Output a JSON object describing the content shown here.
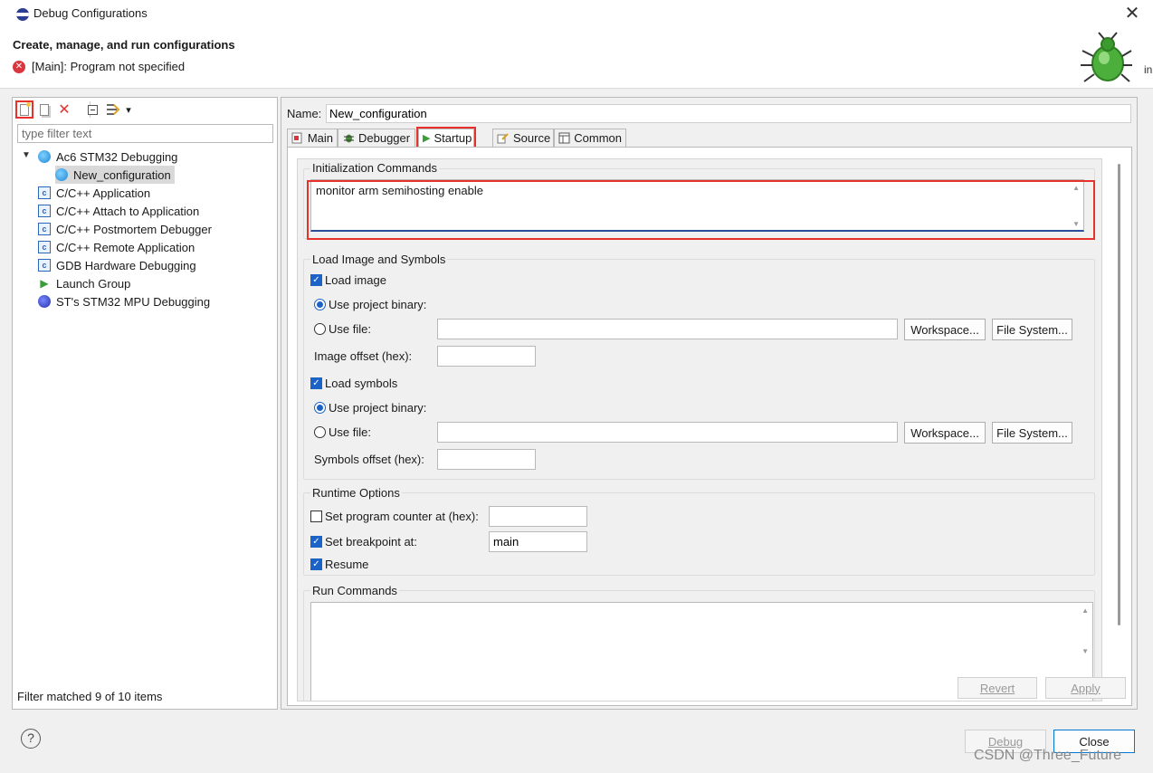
{
  "window": {
    "title": "Debug Configurations",
    "close_glyph": "✕",
    "side_peek_text": "in"
  },
  "header": {
    "title": "Create, manage, and run configurations",
    "error_glyph": "✕",
    "error_message": "[Main]: Program not specified"
  },
  "left": {
    "toolbar": [
      "new-configuration-icon",
      "duplicate-icon",
      "delete-icon",
      "collapse-all-icon",
      "filter-icon",
      "dropdown-icon"
    ],
    "filter_placeholder": "type filter text",
    "tree": [
      {
        "label": "Ac6 STM32 Debugging",
        "icon": "globe-icon",
        "expanded": true
      },
      {
        "label": "New_configuration",
        "icon": "globe-icon",
        "selected": true
      },
      {
        "label": "C/C++ Application",
        "icon": "c-icon"
      },
      {
        "label": "C/C++ Attach to Application",
        "icon": "c-icon"
      },
      {
        "label": "C/C++ Postmortem Debugger",
        "icon": "c-icon"
      },
      {
        "label": "C/C++ Remote Application",
        "icon": "c-icon"
      },
      {
        "label": "GDB Hardware Debugging",
        "icon": "c-icon"
      },
      {
        "label": "Launch Group",
        "icon": "play-icon"
      },
      {
        "label": "ST's STM32 MPU Debugging",
        "icon": "stm-icon"
      }
    ],
    "c_glyph": "c",
    "play_glyph": "▶",
    "status": "Filter matched 9 of 10 items"
  },
  "right": {
    "name_label": "Name:",
    "name_value": "New_configuration",
    "tabs": [
      {
        "label": "Main"
      },
      {
        "label": "Debugger"
      },
      {
        "label": "Startup",
        "active": true
      },
      {
        "label": "Source"
      },
      {
        "label": "Common"
      }
    ],
    "init": {
      "title": "Initialization Commands",
      "text": "monitor arm semihosting enable"
    },
    "load": {
      "title": "Load Image and Symbols",
      "load_image": "Load image",
      "use_project_binary": "Use project binary:",
      "use_file": "Use file:",
      "workspace": "Workspace...",
      "file_system": "File System...",
      "image_offset": "Image offset (hex):",
      "load_symbols": "Load symbols",
      "symbols_offset": "Symbols offset (hex):"
    },
    "runtime": {
      "title": "Runtime Options",
      "set_pc": "Set program counter at (hex):",
      "set_bp": "Set breakpoint at:",
      "bp_value": "main",
      "resume": "Resume"
    },
    "run": {
      "title": "Run Commands"
    },
    "revert": "Revert",
    "apply": "Apply"
  },
  "footer": {
    "help": "?",
    "debug": "Debug",
    "close": "Close",
    "watermark": "CSDN @Three_Future"
  },
  "glyphs": {
    "check": "✓",
    "scroll_up": "▲",
    "scroll_down": "▼",
    "chevron": "▼",
    "dropdown": "▾"
  },
  "colors": {
    "highlight": "#e8312b",
    "accent": "#1b63c6"
  }
}
